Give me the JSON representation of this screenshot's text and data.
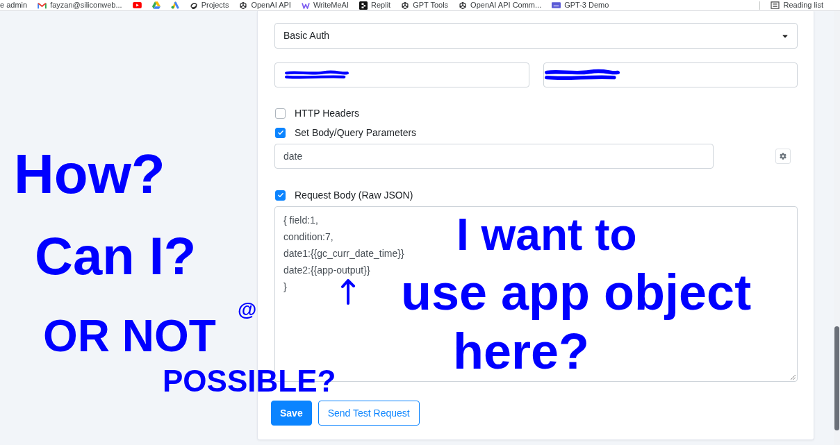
{
  "bookmarks_bar": {
    "items": [
      {
        "label": "e admin"
      },
      {
        "label": "fayzan@siliconweb..."
      },
      {
        "label": "Projects"
      },
      {
        "label": "OpenAI API"
      },
      {
        "label": "WriteMeAI"
      },
      {
        "label": "Replit"
      },
      {
        "label": "GPT Tools"
      },
      {
        "label": "OpenAI API Comm..."
      },
      {
        "label": "GPT-3 Demo"
      }
    ],
    "reading_list": {
      "label": "Reading list"
    }
  },
  "form": {
    "auth_type_select": {
      "value": "Basic Auth"
    },
    "credential_fields": [
      {
        "redacted": true
      },
      {
        "redacted": true
      }
    ],
    "options": [
      {
        "kind": "checkbox",
        "label": "HTTP Headers",
        "checked": false
      },
      {
        "kind": "checkbox_field",
        "label": "Set Body/Query Parameters",
        "checked": true,
        "field_value": "date"
      },
      {
        "kind": "checkbox_textarea",
        "label": "Request Body (Raw JSON)",
        "checked": true,
        "textarea_value": "{ field:1,\ncondition:7,\ndate1:{{gc_curr_date_time}}\ndate2:{{app-output}}\n}"
      }
    ],
    "buttons": [
      {
        "kind": "primary",
        "label": "Save"
      },
      {
        "kind": "outline",
        "label": "Send Test Request"
      }
    ]
  },
  "annotations": [
    {
      "text": "How?"
    },
    {
      "text": "Can I?"
    },
    {
      "text": "@"
    },
    {
      "text": "OR NOT"
    },
    {
      "text": "POSSIBLE?"
    },
    {
      "text": "I want to"
    },
    {
      "text": "use app object"
    },
    {
      "text": "here?"
    }
  ]
}
